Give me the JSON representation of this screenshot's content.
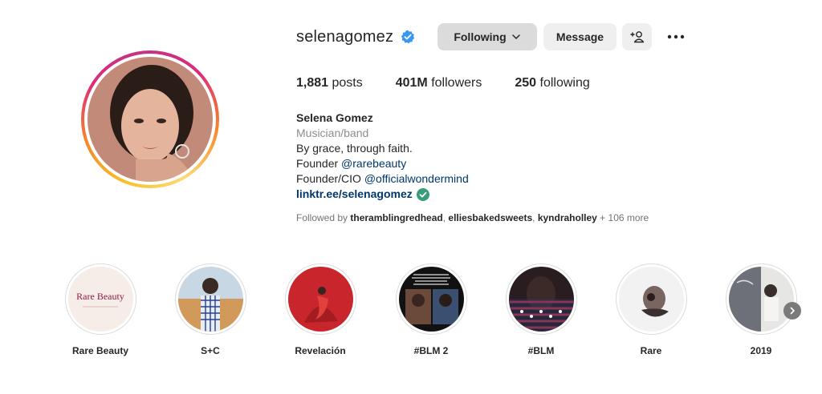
{
  "profile": {
    "username": "selenagomez",
    "full_name": "Selena Gomez",
    "category": "Musician/band",
    "bio_line1": "By grace, through faith.",
    "bio_line2_prefix": "Founder ",
    "bio_line2_mention": "@rarebeauty",
    "bio_line3_prefix": "Founder/CIO ",
    "bio_line3_mention": "@officialwondermind",
    "link": "linktr.ee/selenagomez"
  },
  "buttons": {
    "following": "Following",
    "message": "Message"
  },
  "stats": {
    "posts_count": "1,881",
    "posts_label": " posts",
    "followers_count": "401M",
    "followers_label": " followers",
    "following_count": "250",
    "following_label": " following"
  },
  "followed_by": {
    "prefix": "Followed by ",
    "user1": "theramblingredhead",
    "sep1": ", ",
    "user2": "elliesbakedsweets",
    "sep2": ", ",
    "user3": "kyndraholley",
    "suffix": " + 106 more"
  },
  "highlights": [
    {
      "label": "Rare Beauty",
      "cover_text": "Rare Beauty"
    },
    {
      "label": "S+C"
    },
    {
      "label": "Revelación"
    },
    {
      "label": "#BLM 2"
    },
    {
      "label": "#BLM"
    },
    {
      "label": "Rare"
    },
    {
      "label": "2019"
    }
  ],
  "colors": {
    "verified_blue": "#3897f0",
    "link_badge_green": "#3a9d7a",
    "link_blue": "#00376b"
  }
}
